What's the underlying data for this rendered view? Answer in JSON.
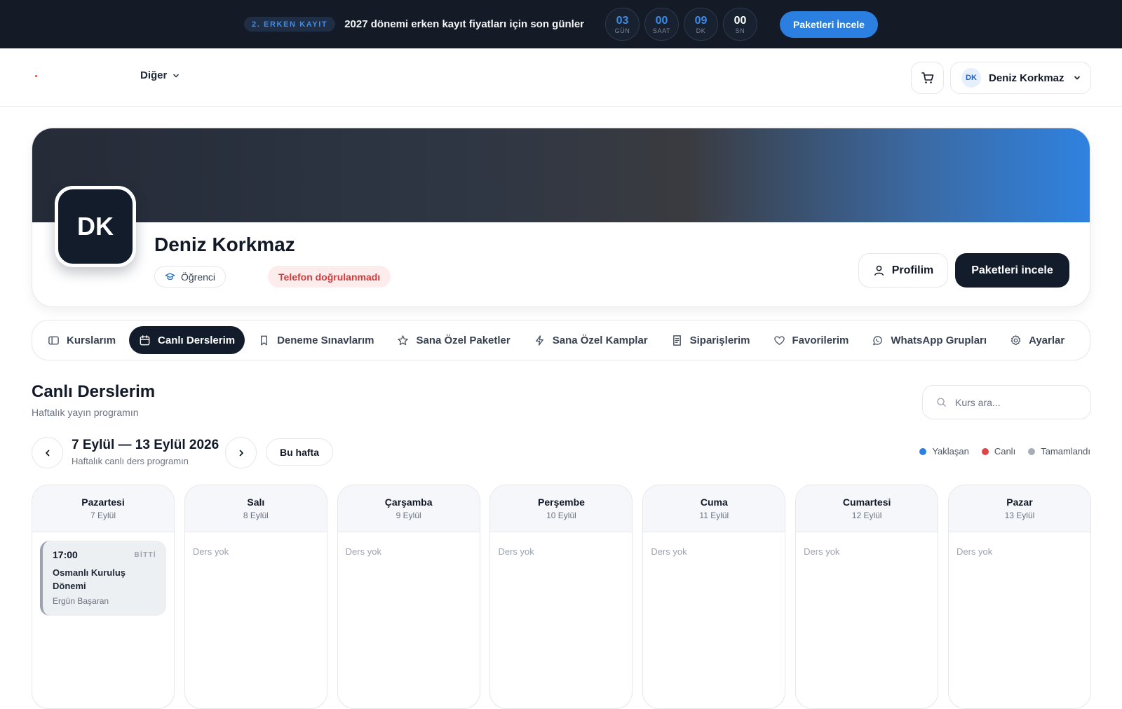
{
  "promo": {
    "badge": "2. ERKEN KAYIT",
    "text": "2027 dönemi erken kayıt fiyatları için son günler",
    "countdown": [
      {
        "value": "03",
        "label": "GÜN"
      },
      {
        "value": "00",
        "label": "SAAT"
      },
      {
        "value": "09",
        "label": "DK"
      },
      {
        "value": "00",
        "label": "SN"
      }
    ],
    "cta": "Paketleri İncele"
  },
  "header": {
    "nav_more": "Diğer",
    "user": {
      "initials": "DK",
      "name": "Deniz Korkmaz"
    }
  },
  "profile": {
    "initials": "DK",
    "name": "Deniz Korkmaz",
    "role": "Öğrenci",
    "warning": "Telefon doğrulanmadı",
    "profile_button": "Profilim",
    "packages_button": "Paketleri incele"
  },
  "tabs": [
    {
      "label": "Kurslarım",
      "icon": "book-icon",
      "active": false
    },
    {
      "label": "Canlı Derslerim",
      "icon": "calendar-icon",
      "active": true
    },
    {
      "label": "Deneme Sınavlarım",
      "icon": "bookmark-icon",
      "active": false
    },
    {
      "label": "Sana Özel Paketler",
      "icon": "star-icon",
      "active": false
    },
    {
      "label": "Sana Özel Kamplar",
      "icon": "bolt-icon",
      "active": false
    },
    {
      "label": "Siparişlerim",
      "icon": "receipt-icon",
      "active": false
    },
    {
      "label": "Favorilerim",
      "icon": "heart-icon",
      "active": false
    },
    {
      "label": "WhatsApp Grupları",
      "icon": "whatsapp-icon",
      "active": false
    },
    {
      "label": "Ayarlar",
      "icon": "gear-icon",
      "active": false
    }
  ],
  "section": {
    "title": "Canlı Derslerim",
    "subtitle": "Haftalık yayın programın",
    "search_placeholder": "Kurs ara..."
  },
  "week": {
    "range": "7 Eylül — 13 Eylül 2026",
    "subtitle": "Haftalık canlı ders programın",
    "this_week": "Bu hafta"
  },
  "legend": [
    {
      "label": "Yaklaşan",
      "color": "#2a7fe0"
    },
    {
      "label": "Canlı",
      "color": "#e04545"
    },
    {
      "label": "Tamamlandı",
      "color": "#a7adb5"
    }
  ],
  "days": [
    {
      "name": "Pazartesi",
      "date": "7 Eylül",
      "lesson": {
        "time": "17:00",
        "state": "BİTTİ",
        "title": "Osmanlı Kuruluş Dönemi",
        "teacher": "Ergün Başaran"
      }
    },
    {
      "name": "Salı",
      "date": "8 Eylül",
      "empty": "Ders yok"
    },
    {
      "name": "Çarşamba",
      "date": "9 Eylül",
      "empty": "Ders yok"
    },
    {
      "name": "Perşembe",
      "date": "10 Eylül",
      "empty": "Ders yok"
    },
    {
      "name": "Cuma",
      "date": "11 Eylül",
      "empty": "Ders yok"
    },
    {
      "name": "Cumartesi",
      "date": "12 Eylül",
      "empty": "Ders yok"
    },
    {
      "name": "Pazar",
      "date": "13 Eylül",
      "empty": "Ders yok"
    }
  ]
}
